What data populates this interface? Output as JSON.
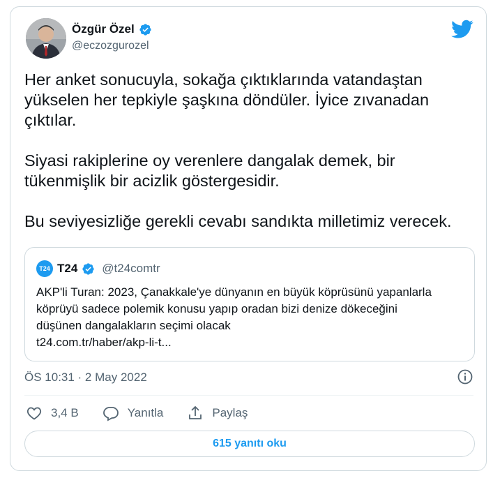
{
  "author": {
    "name": "Özgür Özel",
    "handle": "@eczozgurozel"
  },
  "tweet": {
    "paragraphs": [
      "Her anket sonucuyla, sokağa çıktıklarında vatandaştan yükselen her tepkiyle şaşkına döndüler. İyice zıvanadan çıktılar.",
      "Siyasi rakiplerine oy verenlere dangalak demek, bir tükenmişlik bir acizlik göstergesidir.",
      "Bu seviyesizliğe gerekli cevabı sandıkta milletimiz verecek."
    ]
  },
  "quote": {
    "logo_text": "T24",
    "name": "T24",
    "handle": "@t24comtr",
    "lines": [
      "AKP'li Turan: 2023, Çanakkale'ye dünyanın en büyük köprüsünü yapanlarla",
      "köprüyü sadece polemik konusu yapıp oradan bizi denize dökeceğini",
      "düşünen dangalakların seçimi olacak",
      "t24.com.tr/haber/akp-li-t..."
    ]
  },
  "meta": {
    "timestamp": "ÖS 10:31 · 2 May 2022"
  },
  "actions": {
    "likes": "3,4 B",
    "reply_label": "Yanıtla",
    "share_label": "Paylaş"
  },
  "reply_button": {
    "label": "615 yanıtı oku"
  },
  "colors": {
    "accent": "#1d9bf0",
    "text": "#0f1419",
    "secondary": "#536471",
    "border": "#cfd9de"
  },
  "icons": [
    "verified-badge-icon",
    "twitter-bird-icon",
    "info-icon",
    "heart-icon",
    "reply-bubble-icon",
    "share-icon"
  ]
}
